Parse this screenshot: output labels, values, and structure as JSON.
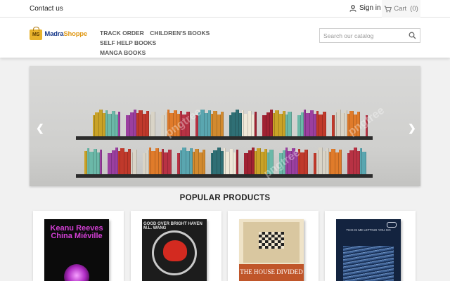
{
  "topbar": {
    "contact_label": "Contact us",
    "signin_label": "Sign in",
    "cart_label": "Cart",
    "cart_count": "(0)"
  },
  "header": {
    "logo_prefix": "Madra",
    "logo_suffix": "Shoppe",
    "logo_mark": "MS",
    "nav": [
      "TRACK ORDER",
      "CHILDREN'S BOOKS",
      "SELF HELP BOOKS",
      "MANGA BOOKS"
    ],
    "search_placeholder": "Search our catalog"
  },
  "carousel": {
    "watermark": "pngtree"
  },
  "section_title": "POPULAR PRODUCTS",
  "products": [
    {
      "cover_text": "Keanu Reeves China Miéville"
    },
    {
      "cover_text": "GOOD OVER BRIGHT HAVEN M.L. WANG"
    },
    {
      "cover_text": "THE HOUSE DIVIDED"
    },
    {
      "cover_text": "THIS IS ME LETTING YOU GO"
    }
  ],
  "colors": {
    "logo_blue": "#1b3c8c",
    "logo_gold": "#e09a1a",
    "shelf": "#2c2c2c"
  }
}
